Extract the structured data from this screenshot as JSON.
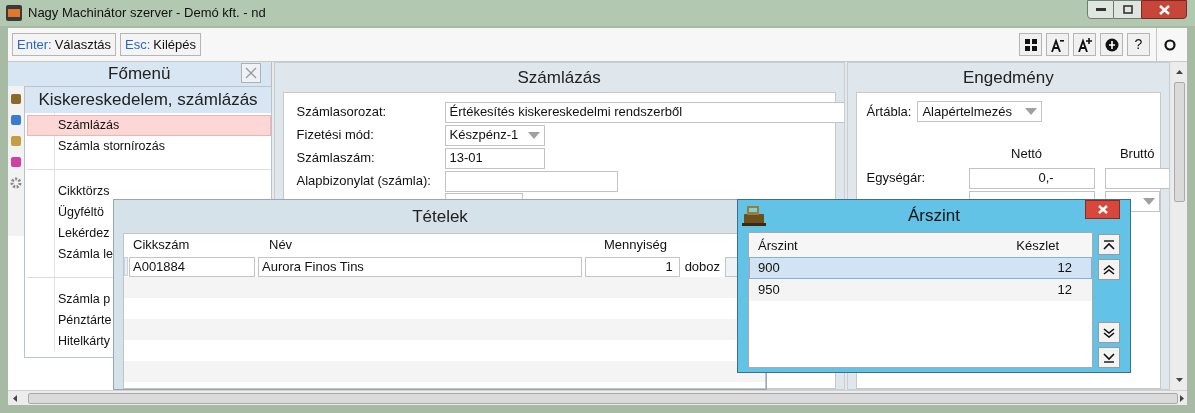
{
  "window": {
    "title": "Nagy Machinátor szerver - Demó kft. - nd"
  },
  "toolbar": {
    "buttons": [
      {
        "key": "Enter:",
        "label": "Választás"
      },
      {
        "key": "Esc:",
        "label": "Kilépés"
      }
    ],
    "help_label": "?"
  },
  "main_menu": {
    "title": "Főmenü",
    "submenu": {
      "title": "Kiskereskedelem, számlázás",
      "items": [
        {
          "kind": "item",
          "label": "Számlázás",
          "selected": true
        },
        {
          "kind": "item",
          "label": "Számla stornírozás",
          "selected": false
        },
        {
          "kind": "separator"
        },
        {
          "kind": "item",
          "label": "Cikktörzs",
          "selected": false
        },
        {
          "kind": "item",
          "label": "Ügyféltö",
          "selected": false
        },
        {
          "kind": "item",
          "label": "Lekérdez",
          "selected": false
        },
        {
          "kind": "item",
          "label": "Számla le",
          "selected": false
        },
        {
          "kind": "separator"
        },
        {
          "kind": "item",
          "label": "Számla p",
          "selected": false
        },
        {
          "kind": "item",
          "label": "Pénztárte",
          "selected": false
        },
        {
          "kind": "item",
          "label": "Hitelkárty",
          "selected": false
        }
      ]
    }
  },
  "invoice_panel": {
    "title": "Számlázás",
    "fields": [
      {
        "kind": "text",
        "label": "Számlasorozat:",
        "value": "Értékesítés kiskereskedelmi rendszerből"
      },
      {
        "kind": "select",
        "label": "Fizetési mód:",
        "value": "Készpénz-1"
      },
      {
        "kind": "text",
        "label": "Számlaszám:",
        "value": "13-01"
      },
      {
        "kind": "text",
        "label": "Alapbizonylat (számla):"
      }
    ]
  },
  "discount_panel": {
    "title": "Engedmény",
    "price_table_label": "Ártábla:",
    "price_table_value": "Alapértelmezés",
    "columns": [
      "Nettó",
      "Bruttó"
    ],
    "unit_price_label": "Egységár:",
    "unit_price_net": "0,-"
  },
  "items_window": {
    "title": "Tételek",
    "columns": [
      "Cikkszám",
      "Név",
      "Mennyiség"
    ],
    "rows": [
      {
        "code": "A001884",
        "name": "Aurora Finos Tins",
        "quantity": "1",
        "unit": "doboz"
      }
    ]
  },
  "price_level_window": {
    "title": "Árszint",
    "columns": [
      "Árszint",
      "Készlet"
    ],
    "rows": [
      {
        "level_name": "900",
        "stock": "12",
        "selected": true
      },
      {
        "level_name": "950",
        "stock": "12",
        "selected": false
      }
    ]
  }
}
